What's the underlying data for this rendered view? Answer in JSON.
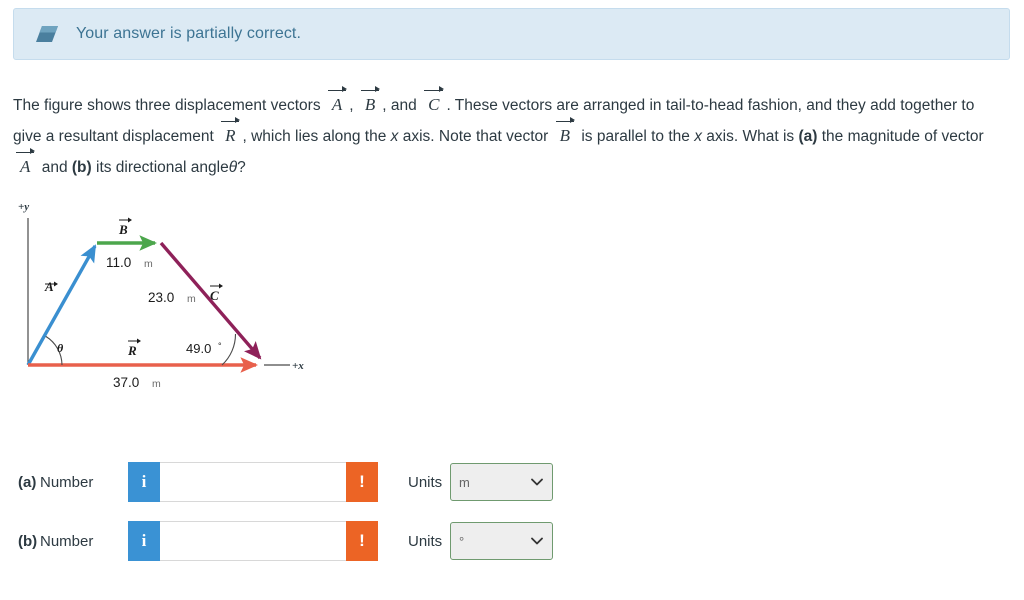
{
  "banner": {
    "icon": "eraser-icon",
    "message": "Your answer is partially correct.",
    "bg_color": "#dceaf4",
    "text_color": "#3d7493"
  },
  "question": {
    "segment_1": "The figure shows three displacement vectors",
    "vec_a_1": "A",
    "comma_1": ",",
    "vec_b_1": "B",
    "and_1": ", and",
    "vec_c_1": "C",
    "segment_2": ". These vectors are arranged in tail-to-head fashion, and they add together to give a resultant displacement",
    "vec_r_1": "R",
    "segment_3": ", which lies along the",
    "x_axis_1": "x",
    "segment_4": "axis. Note that vector",
    "vec_b_2": "B",
    "segment_5": "is parallel to the",
    "x_axis_2": "x",
    "segment_6": "axis. What is",
    "part_a_tag": "(a)",
    "segment_7": "the magnitude of vector",
    "vec_a_2": "A",
    "segment_8": "and",
    "part_b_tag": "(b)",
    "segment_9": "its directional angle",
    "theta_symbol": "θ",
    "segment_10": "?"
  },
  "figure": {
    "axis_y_label": "+y",
    "axis_x_label": "+x",
    "vectors": [
      {
        "name": "A",
        "label": "A",
        "magnitude_label": "",
        "color": "#3a8fd0",
        "from": [
          28,
          173
        ],
        "to": [
          97,
          51
        ]
      },
      {
        "name": "B",
        "label": "B",
        "magnitude_label": "11.0",
        "unit": "m",
        "color": "#4ca64c",
        "from": [
          97,
          51
        ],
        "to": [
          161,
          51
        ]
      },
      {
        "name": "C",
        "label": "C",
        "magnitude_label": "23.0",
        "unit": "m",
        "color": "#8e2159",
        "from": [
          161,
          51
        ],
        "to": [
          264,
          171
        ]
      },
      {
        "name": "R",
        "label": "R",
        "magnitude_label": "37.0",
        "unit": "m",
        "color": "#e8604c",
        "from": [
          28,
          173
        ],
        "to": [
          264,
          173
        ]
      }
    ],
    "angle_theta": "θ",
    "angle_c": "49.0",
    "angle_c_degree": "°",
    "origin": [
      28,
      173
    ]
  },
  "answers": [
    {
      "tag": "(a)",
      "label": "Number",
      "info_icon": "info-icon",
      "info_glyph": "i",
      "input_value": "",
      "input_placeholder": "",
      "alert_icon": "alert-icon",
      "alert_glyph": "!",
      "units_label": "Units",
      "units_value": "m",
      "units_options": [
        "m"
      ]
    },
    {
      "tag": "(b)",
      "label": "Number",
      "info_icon": "info-icon",
      "info_glyph": "i",
      "input_value": "",
      "input_placeholder": "",
      "alert_icon": "alert-icon",
      "alert_glyph": "!",
      "units_label": "Units",
      "units_value": "°",
      "units_options": [
        "°"
      ]
    }
  ],
  "colors": {
    "vector_a": "#3a8fd0",
    "vector_b": "#4ca64c",
    "vector_c": "#8e2159",
    "vector_r": "#e8604c",
    "info_blue": "#3a92d4",
    "alert_orange": "#ec6425",
    "select_border_green": "#6f9a6f"
  }
}
